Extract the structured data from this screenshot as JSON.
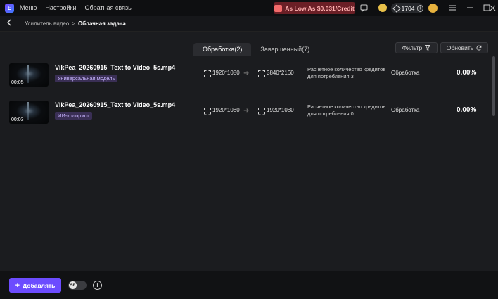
{
  "titlebar": {
    "menu": [
      "Меню",
      "Настройки",
      "Обратная связь"
    ],
    "promo_label": "As Low As $0.031/Credit",
    "credits": "1704"
  },
  "breadcrumb": {
    "parent": "Усилитель видео",
    "separator": ">",
    "current": "Облачная задача"
  },
  "tabs": [
    {
      "label": "Обработка(2)",
      "active": true
    },
    {
      "label": "Завершенный(7)",
      "active": false
    }
  ],
  "toolbar": {
    "filter_label": "Фильтр",
    "refresh_label": "Обновить"
  },
  "tasks": [
    {
      "filename": "VikPea_20260915_Text to Video_5s.mp4",
      "duration": "00:05",
      "model": "Универсальная модель",
      "src_res": "1920*1080",
      "dst_res": "3840*2160",
      "credit_line1": "Расчетное количество кредитов",
      "credit_line2": "для потребления:3",
      "status": "Обработка",
      "progress": "0.00%"
    },
    {
      "filename": "VikPea_20260915_Text to Video_5s.mp4",
      "duration": "00:03",
      "model": "ИИ-колорист",
      "src_res": "1920*1080",
      "dst_res": "1920*1080",
      "credit_line1": "Расчетное количество кредитов",
      "credit_line2": "для потребления:0",
      "status": "Обработка",
      "progress": "0.00%"
    }
  ],
  "bottom": {
    "add_label": "Добавлять",
    "toggle_label": "SE",
    "info_glyph": "i"
  },
  "colors": {
    "accent": "#6c4cff",
    "promo_bg": "#6b1f26",
    "tag_bg": "#3a2f55"
  }
}
